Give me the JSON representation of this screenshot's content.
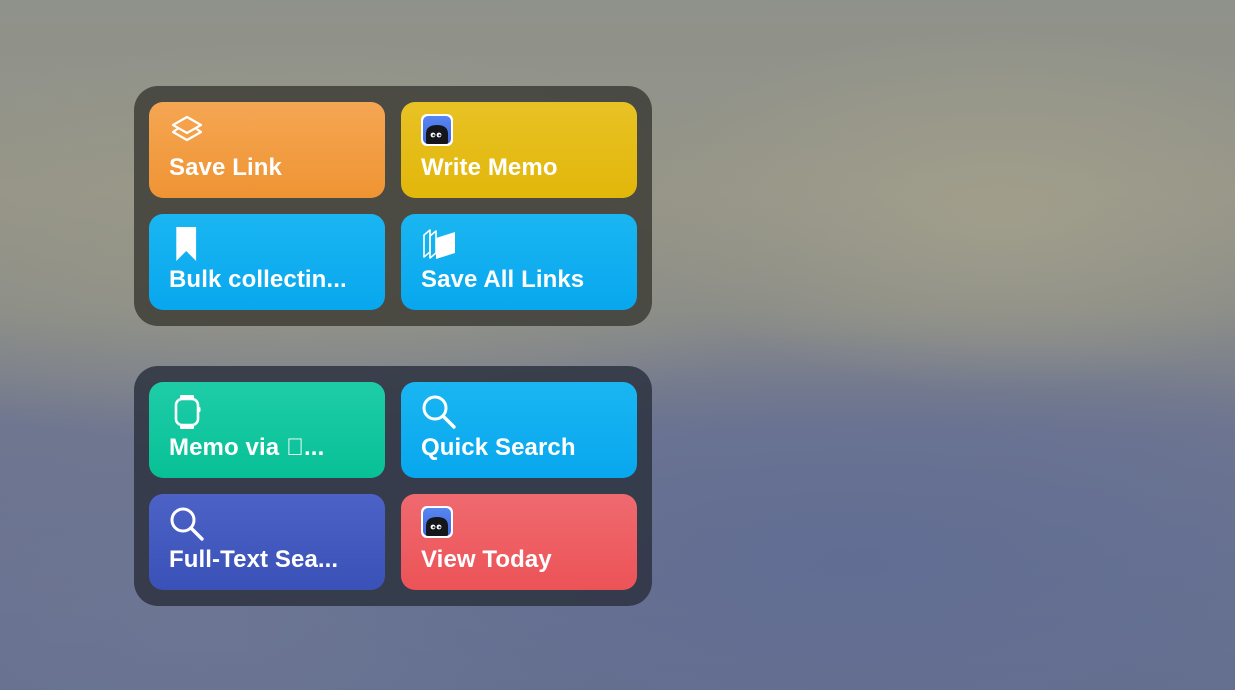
{
  "widgets": [
    {
      "tiles": [
        {
          "label": "Save Link",
          "icon": "layers-icon",
          "color": "#f19a3e"
        },
        {
          "label": "Write Memo",
          "icon": "app-mascot-icon",
          "color": "#e4bb14"
        },
        {
          "label": "Bulk collectin...",
          "icon": "bookmark-icon",
          "color": "#10aef0"
        },
        {
          "label": "Save All Links",
          "icon": "books-icon",
          "color": "#10aef0"
        }
      ]
    },
    {
      "tiles": [
        {
          "label": "Memo via ...",
          "icon": "apple-watch-icon",
          "color": "#12c69f"
        },
        {
          "label": "Quick Search",
          "icon": "search-icon",
          "color": "#10aef0"
        },
        {
          "label": "Full-Text Sea...",
          "icon": "search-icon",
          "color": "#4259be"
        },
        {
          "label": "View Today",
          "icon": "app-mascot-icon",
          "color": "#ed5e62"
        }
      ]
    }
  ]
}
